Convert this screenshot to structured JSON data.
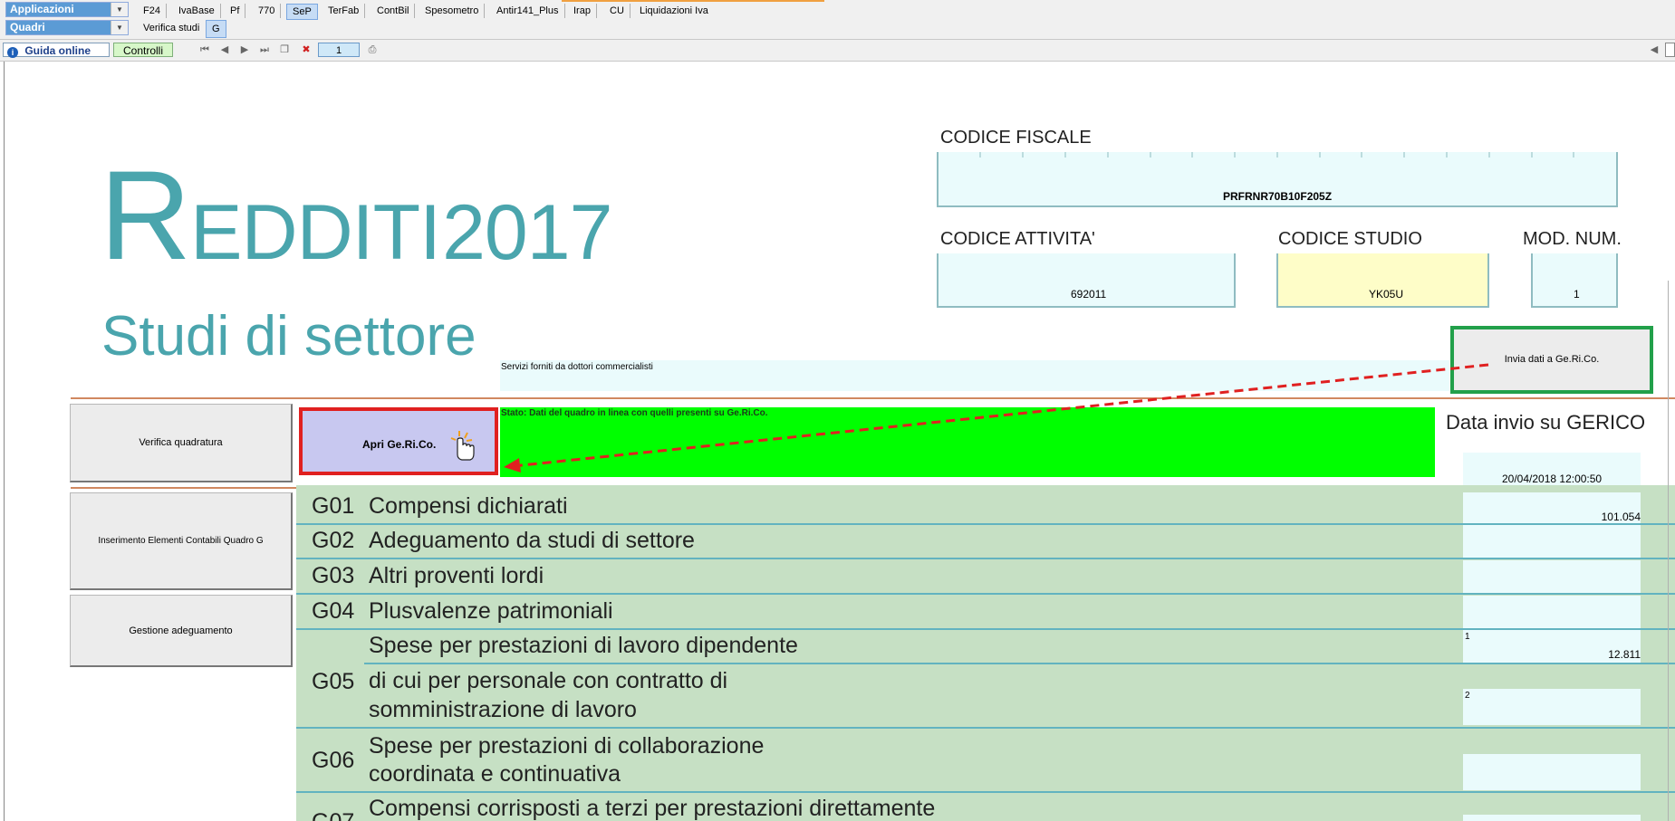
{
  "top": {
    "applicazioni_label": "Applicazioni",
    "quadri_label": "Quadri",
    "app_tabs": [
      "F24",
      "IvaBase",
      "Pf",
      "770",
      "SeP",
      "TerFab",
      "ContBil",
      "Spesometro",
      "Antir141_Plus",
      "Irap",
      "CU",
      "Liquidazioni Iva"
    ],
    "active_app_tab": "SeP",
    "sub_tabs": [
      "Verifica studi",
      "G"
    ],
    "guida_label": "Guida online",
    "controlli_label": "Controlli",
    "page_number": "1"
  },
  "header": {
    "title_first": "R",
    "title_rest": "EDDITI",
    "title_year": "2017",
    "subtitle": "Studi di settore"
  },
  "codice_fiscale": {
    "label": "CODICE FISCALE",
    "value": "PRFRNR70B10F205Z"
  },
  "codice_attivita": {
    "label": "CODICE ATTIVITA'",
    "value": "692011"
  },
  "codice_studio": {
    "label": "CODICE STUDIO",
    "value": "YK05U"
  },
  "mod_num": {
    "label": "MOD. NUM.",
    "value": "1"
  },
  "servizi_text": "Servizi forniti da dottori commercialisti",
  "invia_button": "Invia dati a Ge.Ri.Co.",
  "apri_button": "Apri Ge.Ri.Co.",
  "stato_text": "Stato: Dati del quadro in linea con quelli presenti su Ge.Ri.Co.",
  "data_invio": {
    "label": "Data invio su GERICO",
    "value": "20/04/2018 12:00:50"
  },
  "side_buttons": {
    "verifica": "Verifica quadratura",
    "inserimento": "Inserimento Elementi Contabili Quadro G",
    "gestione": "Gestione adeguamento"
  },
  "rows": {
    "g01": {
      "code": "G01",
      "text": "Compensi dichiarati",
      "value": "101.054"
    },
    "g02": {
      "code": "G02",
      "text": "Adeguamento da studi di settore"
    },
    "g03": {
      "code": "G03",
      "text": "Altri proventi lordi"
    },
    "g04": {
      "code": "G04",
      "text": "Plusvalenze patrimoniali"
    },
    "g05": {
      "code": "G05",
      "text1": "Spese per prestazioni di lavoro dipendente",
      "sup1": "1",
      "value1": "12.811",
      "text2": "di cui per personale con contratto di",
      "text3": "somministrazione di lavoro",
      "sup2": "2"
    },
    "g06": {
      "code": "G06",
      "text1": "Spese per prestazioni di collaborazione",
      "text2": "coordinata e continuativa"
    },
    "g07": {
      "code": "G07",
      "text1": "Compensi corrisposti a terzi per prestazioni direttamente"
    }
  },
  "colors": {
    "title_teal": "#4aa5ad",
    "table_green": "#c6e0c4",
    "stato_green": "#00ff00",
    "apri_bg": "#c8c8f0",
    "highlight_red": "#e02020",
    "highlight_green": "#22a04a",
    "arrow_red": "#e02020",
    "studio_yellow": "#fefdc8"
  }
}
